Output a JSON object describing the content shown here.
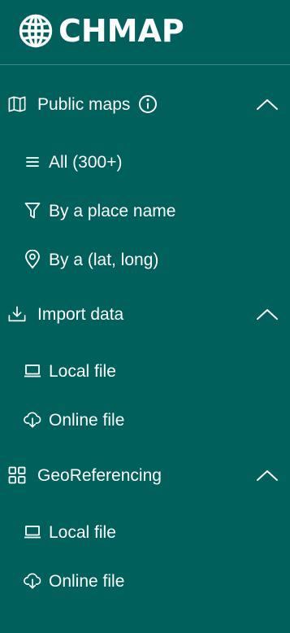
{
  "app": {
    "title": "CHMAP",
    "logo_icon": "globe-icon"
  },
  "sections": {
    "public_maps": {
      "label": "Public maps",
      "icon": "map-icon",
      "expanded": true,
      "items": [
        {
          "label": "All (300+)",
          "icon": "list-icon"
        },
        {
          "label": "By a place name",
          "icon": "filter-icon"
        },
        {
          "label": "By a (lat, long)",
          "icon": "location-pin-icon"
        }
      ]
    },
    "import_data": {
      "label": "Import data",
      "icon": "download-icon",
      "expanded": true,
      "items": [
        {
          "label": "Local file",
          "icon": "laptop-icon"
        },
        {
          "label": "Online file",
          "icon": "cloud-download-icon"
        }
      ]
    },
    "georeferencing": {
      "label": "GeoReferencing",
      "icon": "grid-icon",
      "expanded": true,
      "items": [
        {
          "label": "Local file",
          "icon": "laptop-icon"
        },
        {
          "label": "Online file",
          "icon": "cloud-download-icon"
        }
      ]
    }
  },
  "colors": {
    "background": "#00605b",
    "text": "#ffffff",
    "divider": "#3f8a86"
  }
}
